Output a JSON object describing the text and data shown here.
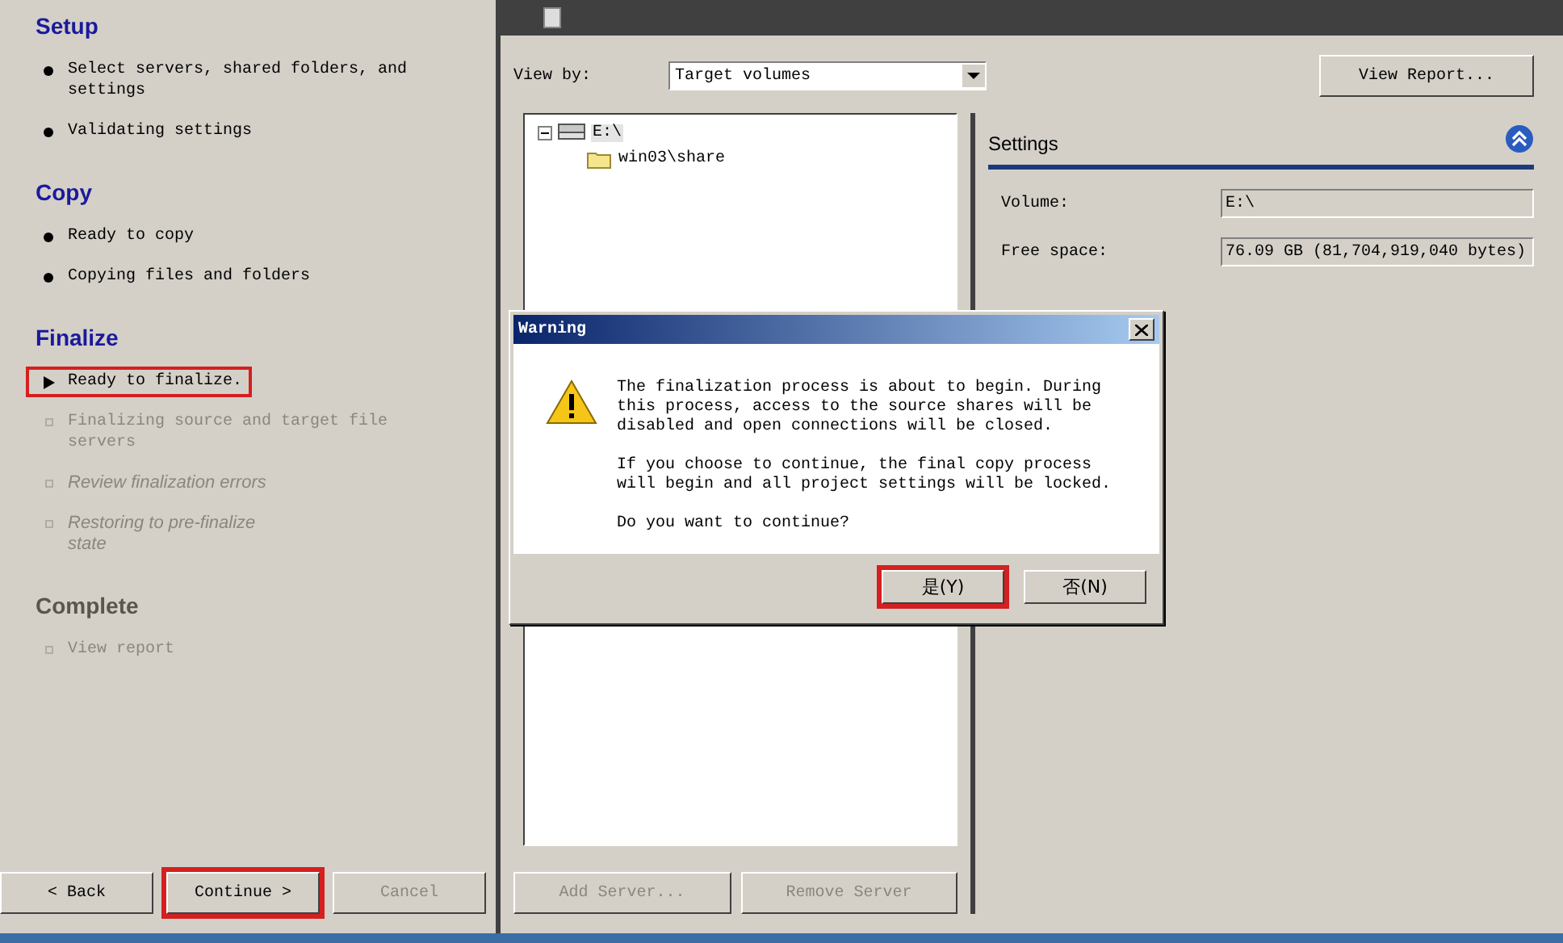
{
  "sections": [
    {
      "title": "Setup",
      "enabled": true,
      "items": [
        {
          "label": "Select servers, shared folders, and settings",
          "done": true,
          "current": false,
          "kind": "required",
          "highlighted": false
        },
        {
          "label": "Validating settings",
          "done": true,
          "current": false,
          "kind": "required",
          "highlighted": false
        }
      ]
    },
    {
      "title": "Copy",
      "enabled": true,
      "items": [
        {
          "label": "Ready to copy",
          "done": true,
          "current": false,
          "kind": "required",
          "highlighted": false
        },
        {
          "label": "Copying files and folders",
          "done": true,
          "current": false,
          "kind": "required",
          "highlighted": false
        }
      ]
    },
    {
      "title": "Finalize",
      "enabled": true,
      "items": [
        {
          "label": "Ready to finalize.",
          "current": true,
          "kind": "required",
          "highlighted": true
        },
        {
          "label": "Finalizing source and target file servers",
          "done": false,
          "current": false,
          "kind": "required",
          "highlighted": false
        },
        {
          "label": "Review finalization errors",
          "done": false,
          "current": false,
          "kind": "optional",
          "highlighted": false
        },
        {
          "label": "Restoring to pre-finalize state",
          "done": false,
          "current": false,
          "kind": "optional",
          "highlighted": false
        }
      ]
    },
    {
      "title": "Complete",
      "enabled": false,
      "items": [
        {
          "label": "View report",
          "done": false,
          "current": false,
          "kind": "required",
          "highlighted": false
        }
      ]
    }
  ],
  "nav_buttons": [
    {
      "label": "< Back",
      "disabled": false,
      "highlighted": false
    },
    {
      "label": "Continue >",
      "disabled": false,
      "highlighted": true
    },
    {
      "label": "Cancel",
      "disabled": true,
      "highlighted": false
    }
  ],
  "view_by": {
    "label": "View by:",
    "value": "Target volumes"
  },
  "view_report_button": "View Report...",
  "tree": [
    {
      "label": "E:\\",
      "expanded": true,
      "selected": true,
      "children": [
        {
          "label": "win03\\share"
        }
      ]
    }
  ],
  "settings": {
    "title": "Settings",
    "fields": [
      {
        "label": "Volume:",
        "value": "E:\\"
      },
      {
        "label": "Free space:",
        "value": "76.09 GB (81,704,919,040 bytes)"
      }
    ]
  },
  "server_buttons": [
    {
      "label": "Add Server...",
      "disabled": true
    },
    {
      "label": "Remove Server",
      "disabled": true
    }
  ],
  "dialog": {
    "title": "Warning",
    "paragraphs": [
      "The finalization process is about to begin. During this process, access to the source shares will be disabled and open connections will be closed.",
      "If you choose to continue, the final copy process will begin and all project settings will be locked.",
      "Do you want to continue?"
    ],
    "buttons": [
      {
        "label": "是(Y)",
        "highlighted": true
      },
      {
        "label": "否(N)",
        "highlighted": false
      }
    ]
  }
}
